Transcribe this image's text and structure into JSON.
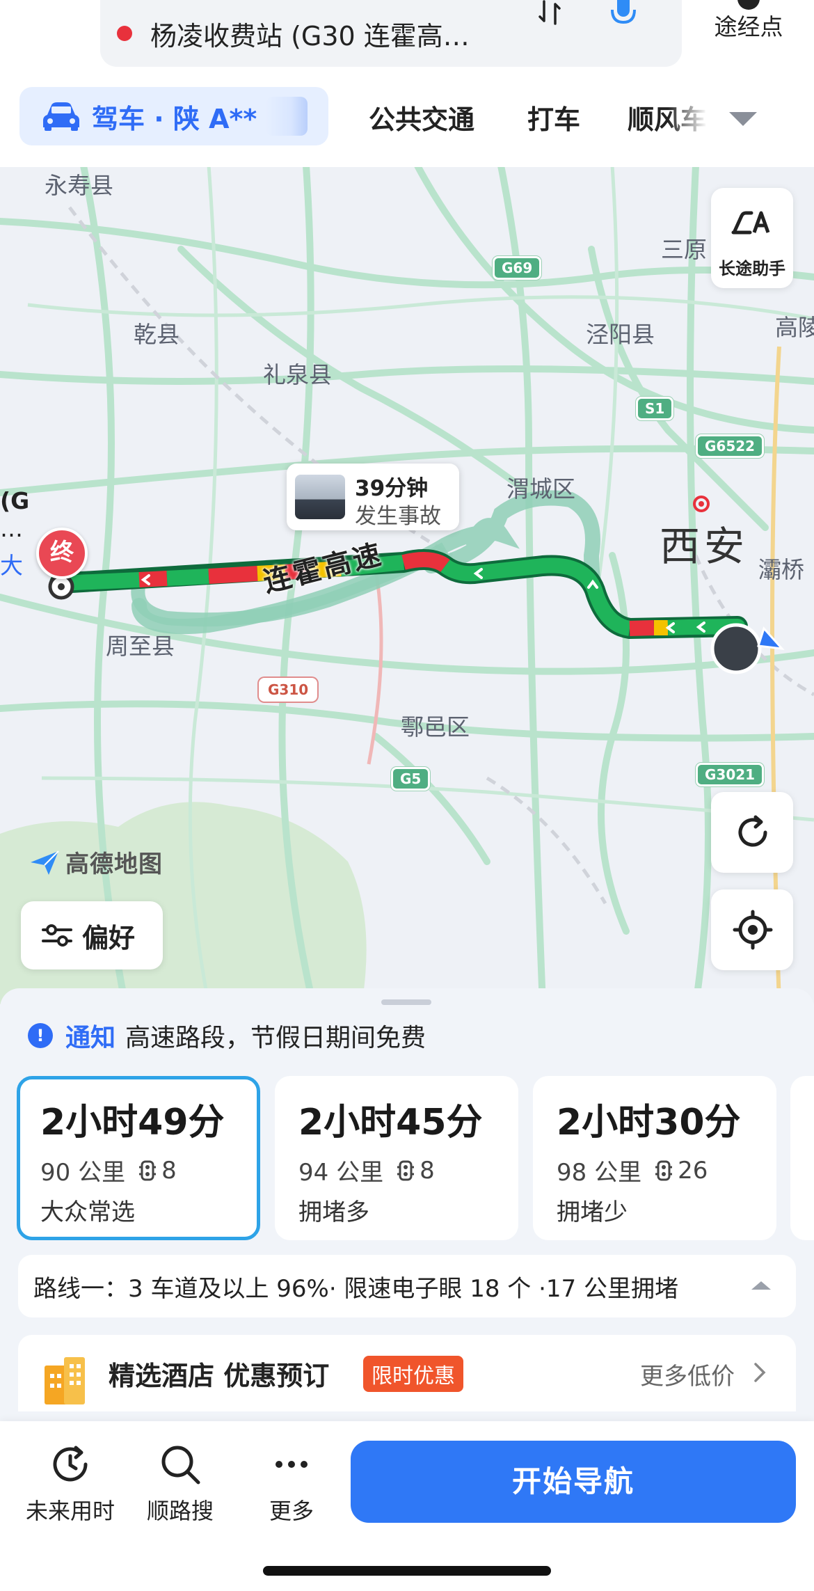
{
  "destination": {
    "text": "杨凌收费站 (G30 连霍高…"
  },
  "waypoint": {
    "label": "途经点"
  },
  "modes": {
    "active": "驾车 · 陕 A**",
    "items": [
      "公共交通",
      "打车",
      "顺风车"
    ]
  },
  "map": {
    "places": {
      "yongshou": "永寿县",
      "qianxian": "乾县",
      "liquan": "礼泉县",
      "jingyang": "泾阳县",
      "sanyuan": "三原",
      "gaoling": "高陵",
      "weicheng": "渭城区",
      "xian": "西安",
      "baqiao": "灞桥",
      "zhouzhi": "周至县",
      "huyi": "鄠邑区",
      "edge_left_1": "(G",
      "edge_left_2": "…",
      "edge_left_3": "大"
    },
    "road_badges": [
      "G69",
      "S1",
      "G6522",
      "G310",
      "G5",
      "G3021"
    ],
    "highway_label": "连霍高速",
    "incident": {
      "duration": "39分钟",
      "type": "发生事故"
    },
    "end_marker": "终",
    "long_trip_label": "长途助手",
    "logo_text": "高德地图",
    "preference_label": "偏好"
  },
  "notice": {
    "tag": "通知",
    "message": "高速路段，节假日期间免费"
  },
  "routes": [
    {
      "time": "2小时49分",
      "distance": "90 公里",
      "lights": "8",
      "tag": "大众常选"
    },
    {
      "time": "2小时45分",
      "distance": "94 公里",
      "lights": "8",
      "tag": "拥堵多"
    },
    {
      "time": "2小时30分",
      "distance": "98 公里",
      "lights": "26",
      "tag": "拥堵少"
    }
  ],
  "route_summary": "路线一：3 车道及以上 96%· 限速电子眼 18 个 ·17 公里拥堵",
  "hotel": {
    "title": "精选酒店 优惠预订",
    "promo": "限时优惠",
    "more": "更多低价"
  },
  "bottom": {
    "future_time": "未来用时",
    "along_search": "顺路搜",
    "more": "更多",
    "start_nav": "开始导航"
  },
  "colors": {
    "accent": "#2f6cf6",
    "jam": "#e8313c",
    "slow": "#f5c200",
    "clear": "#1fb45a",
    "route_alt": "#9fd6c1"
  },
  "icons": [
    "car-icon",
    "swap-icon",
    "mic-icon",
    "chevron-down-icon",
    "long-trip-icon",
    "refresh-icon",
    "locate-icon",
    "sliders-icon",
    "info-icon",
    "traffic-light-icon",
    "hotel-icon",
    "clock-icon",
    "search-icon",
    "more-dots-icon"
  ]
}
